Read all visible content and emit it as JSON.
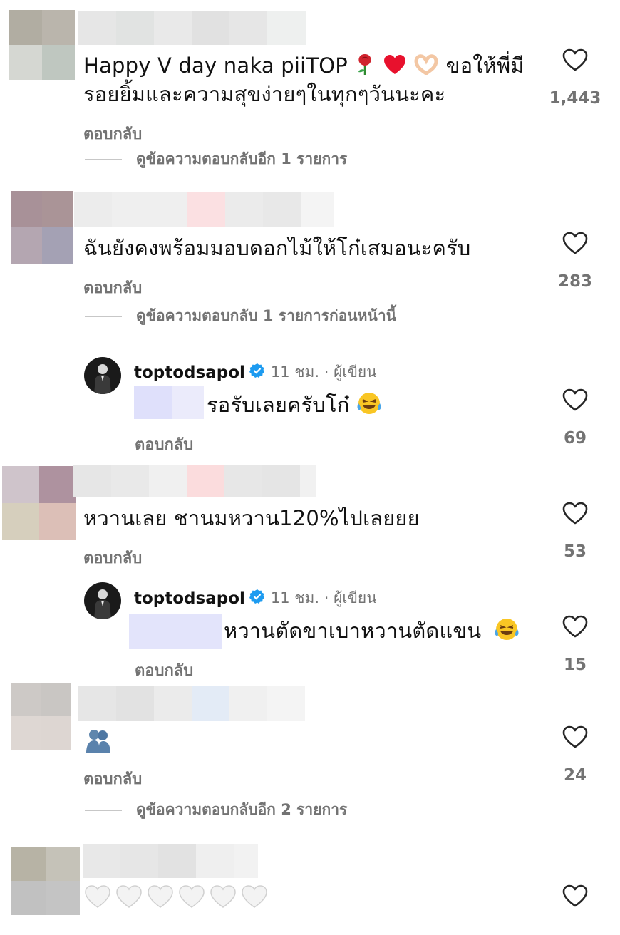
{
  "comments": [
    {
      "text_line1": "Happy V day naka piiTOP",
      "text_line1_thai": "ขอให้พี่มี",
      "text_line2": "รอยยิ้มและความสุขง่ายๆในทุกๆวันนะคะ",
      "reply_label": "ตอบกลับ",
      "likes": "1,443",
      "view_replies": "ดูข้อความตอบกลับอีก 1 รายการ"
    },
    {
      "text": "ฉันยังคงพร้อมมอบดอกไม้ให้โก๋เสมอนะครับ",
      "reply_label": "ตอบกลับ",
      "likes": "283",
      "view_replies": "ดูข้อความตอบกลับ 1 รายการก่อนหน้านี้"
    },
    {
      "text": "หวานเลย ชานมหวาน120%ไปเลยยย",
      "reply_label": "ตอบกลับ",
      "likes": "53"
    },
    {
      "reply_label": "ตอบกลับ",
      "likes": "24",
      "view_replies": "ดูข้อความตอบกลับอีก 2 รายการ"
    },
    {}
  ],
  "replies": [
    {
      "username": "toptodsapol",
      "meta": "11 ชม. · ผู้เขียน",
      "text": "รอรับเลยครับโก๋",
      "reply_label": "ตอบกลับ",
      "likes": "69"
    },
    {
      "username": "toptodsapol",
      "meta": "11 ชม. · ผู้เขียน",
      "text": "หวานตัดขาเบาหวานตัดแขน",
      "reply_label": "ตอบกลับ",
      "likes": "15"
    }
  ],
  "icons": {
    "like": "heart-outline-icon",
    "verified": "verified-badge-icon"
  },
  "colors": {
    "verified": "#1d9bf0",
    "muted": "#737373"
  }
}
